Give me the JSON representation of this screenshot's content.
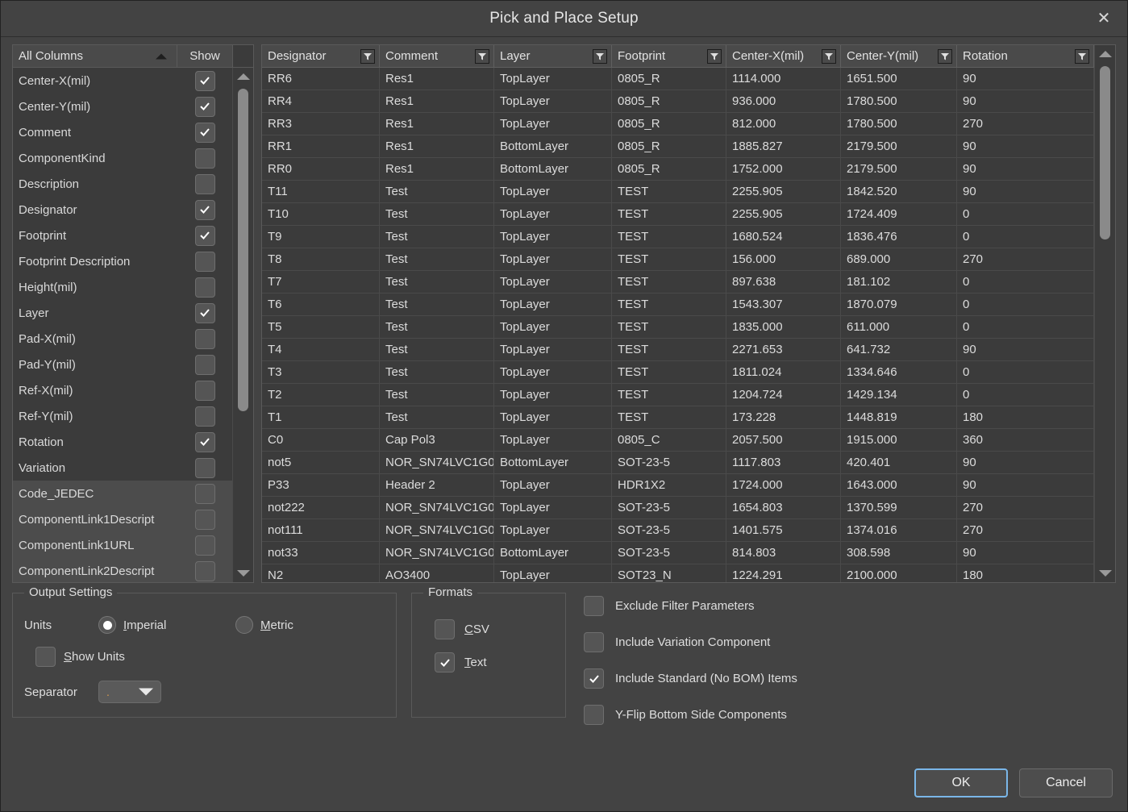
{
  "window": {
    "title": "Pick and Place Setup",
    "close_icon": "close-icon"
  },
  "column_list": {
    "header": {
      "all_columns": "All Columns",
      "show": "Show",
      "sort_icon": "sort-ascending-icon"
    },
    "items": [
      {
        "label": "Center-X(mil)",
        "checked": true,
        "selected": false
      },
      {
        "label": "Center-Y(mil)",
        "checked": true,
        "selected": false
      },
      {
        "label": "Comment",
        "checked": true,
        "selected": false
      },
      {
        "label": "ComponentKind",
        "checked": false,
        "selected": false
      },
      {
        "label": "Description",
        "checked": false,
        "selected": false
      },
      {
        "label": "Designator",
        "checked": true,
        "selected": false
      },
      {
        "label": "Footprint",
        "checked": true,
        "selected": false
      },
      {
        "label": "Footprint Description",
        "checked": false,
        "selected": false
      },
      {
        "label": "Height(mil)",
        "checked": false,
        "selected": false
      },
      {
        "label": "Layer",
        "checked": true,
        "selected": false
      },
      {
        "label": "Pad-X(mil)",
        "checked": false,
        "selected": false
      },
      {
        "label": "Pad-Y(mil)",
        "checked": false,
        "selected": false
      },
      {
        "label": "Ref-X(mil)",
        "checked": false,
        "selected": false
      },
      {
        "label": "Ref-Y(mil)",
        "checked": false,
        "selected": false
      },
      {
        "label": "Rotation",
        "checked": true,
        "selected": false
      },
      {
        "label": "Variation",
        "checked": false,
        "selected": false
      },
      {
        "label": "Code_JEDEC",
        "checked": false,
        "selected": true
      },
      {
        "label": "ComponentLink1Descript",
        "checked": false,
        "selected": true
      },
      {
        "label": "ComponentLink1URL",
        "checked": false,
        "selected": true
      },
      {
        "label": "ComponentLink2Descript",
        "checked": false,
        "selected": true
      }
    ]
  },
  "table": {
    "columns": [
      {
        "label": "Designator",
        "filter_icon": "filter-icon"
      },
      {
        "label": "Comment",
        "filter_icon": "filter-icon"
      },
      {
        "label": "Layer",
        "filter_icon": "filter-icon"
      },
      {
        "label": "Footprint",
        "filter_icon": "filter-icon"
      },
      {
        "label": "Center-X(mil)",
        "filter_icon": "filter-icon"
      },
      {
        "label": "Center-Y(mil)",
        "filter_icon": "filter-icon"
      },
      {
        "label": "Rotation",
        "filter_icon": "filter-icon"
      }
    ],
    "rows": [
      [
        "RR6",
        "Res1",
        "TopLayer",
        "0805_R",
        "1114.000",
        "1651.500",
        "90"
      ],
      [
        "RR4",
        "Res1",
        "TopLayer",
        "0805_R",
        "936.000",
        "1780.500",
        "90"
      ],
      [
        "RR3",
        "Res1",
        "TopLayer",
        "0805_R",
        "812.000",
        "1780.500",
        "270"
      ],
      [
        "RR1",
        "Res1",
        "BottomLayer",
        "0805_R",
        "1885.827",
        "2179.500",
        "90"
      ],
      [
        "RR0",
        "Res1",
        "BottomLayer",
        "0805_R",
        "1752.000",
        "2179.500",
        "90"
      ],
      [
        "T11",
        "Test",
        "TopLayer",
        "TEST",
        "2255.905",
        "1842.520",
        "90"
      ],
      [
        "T10",
        "Test",
        "TopLayer",
        "TEST",
        "2255.905",
        "1724.409",
        "0"
      ],
      [
        "T9",
        "Test",
        "TopLayer",
        "TEST",
        "1680.524",
        "1836.476",
        "0"
      ],
      [
        "T8",
        "Test",
        "TopLayer",
        "TEST",
        "156.000",
        "689.000",
        "270"
      ],
      [
        "T7",
        "Test",
        "TopLayer",
        "TEST",
        "897.638",
        "181.102",
        "0"
      ],
      [
        "T6",
        "Test",
        "TopLayer",
        "TEST",
        "1543.307",
        "1870.079",
        "0"
      ],
      [
        "T5",
        "Test",
        "TopLayer",
        "TEST",
        "1835.000",
        "611.000",
        "0"
      ],
      [
        "T4",
        "Test",
        "TopLayer",
        "TEST",
        "2271.653",
        "641.732",
        "90"
      ],
      [
        "T3",
        "Test",
        "TopLayer",
        "TEST",
        "1811.024",
        "1334.646",
        "0"
      ],
      [
        "T2",
        "Test",
        "TopLayer",
        "TEST",
        "1204.724",
        "1429.134",
        "0"
      ],
      [
        "T1",
        "Test",
        "TopLayer",
        "TEST",
        "173.228",
        "1448.819",
        "180"
      ],
      [
        "C0",
        "Cap Pol3",
        "TopLayer",
        "0805_C",
        "2057.500",
        "1915.000",
        "360"
      ],
      [
        "not5",
        "NOR_SN74LVC1G0",
        "BottomLayer",
        "SOT-23-5",
        "1117.803",
        "420.401",
        "90"
      ],
      [
        "P33",
        "Header 2",
        "TopLayer",
        "HDR1X2",
        "1724.000",
        "1643.000",
        "90"
      ],
      [
        "not222",
        "NOR_SN74LVC1G0",
        "TopLayer",
        "SOT-23-5",
        "1654.803",
        "1370.599",
        "270"
      ],
      [
        "not111",
        "NOR_SN74LVC1G0",
        "TopLayer",
        "SOT-23-5",
        "1401.575",
        "1374.016",
        "270"
      ],
      [
        "not33",
        "NOR_SN74LVC1G0",
        "BottomLayer",
        "SOT-23-5",
        "814.803",
        "308.598",
        "90"
      ],
      [
        "N2",
        "AO3400",
        "TopLayer",
        "SOT23_N",
        "1224.291",
        "2100.000",
        "180"
      ]
    ]
  },
  "output_settings": {
    "legend": "Output Settings",
    "units_label": "Units",
    "imperial": {
      "label": "Imperial",
      "selected": true
    },
    "metric": {
      "label": "Metric",
      "selected": false
    },
    "show_units": {
      "label": "Show Units",
      "checked": false
    },
    "separator_label": "Separator",
    "separator_value": "."
  },
  "formats": {
    "legend": "Formats",
    "csv": {
      "label": "CSV",
      "checked": false
    },
    "text": {
      "label": "Text",
      "checked": true
    }
  },
  "extra_options": [
    {
      "label": "Exclude Filter Parameters",
      "checked": false
    },
    {
      "label": "Include Variation Component",
      "checked": false
    },
    {
      "label": "Include Standard (No BOM) Items",
      "checked": true
    },
    {
      "label": "Y-Flip Bottom Side Components",
      "checked": false
    }
  ],
  "footer": {
    "ok": "OK",
    "cancel": "Cancel"
  },
  "colors": {
    "dialog_bg": "#434343",
    "panel_bg": "#3b3b3b",
    "header_bg": "#4a4a4a",
    "accent_focus": "#7ab6e8",
    "separator_value_color": "#d99b4e"
  }
}
